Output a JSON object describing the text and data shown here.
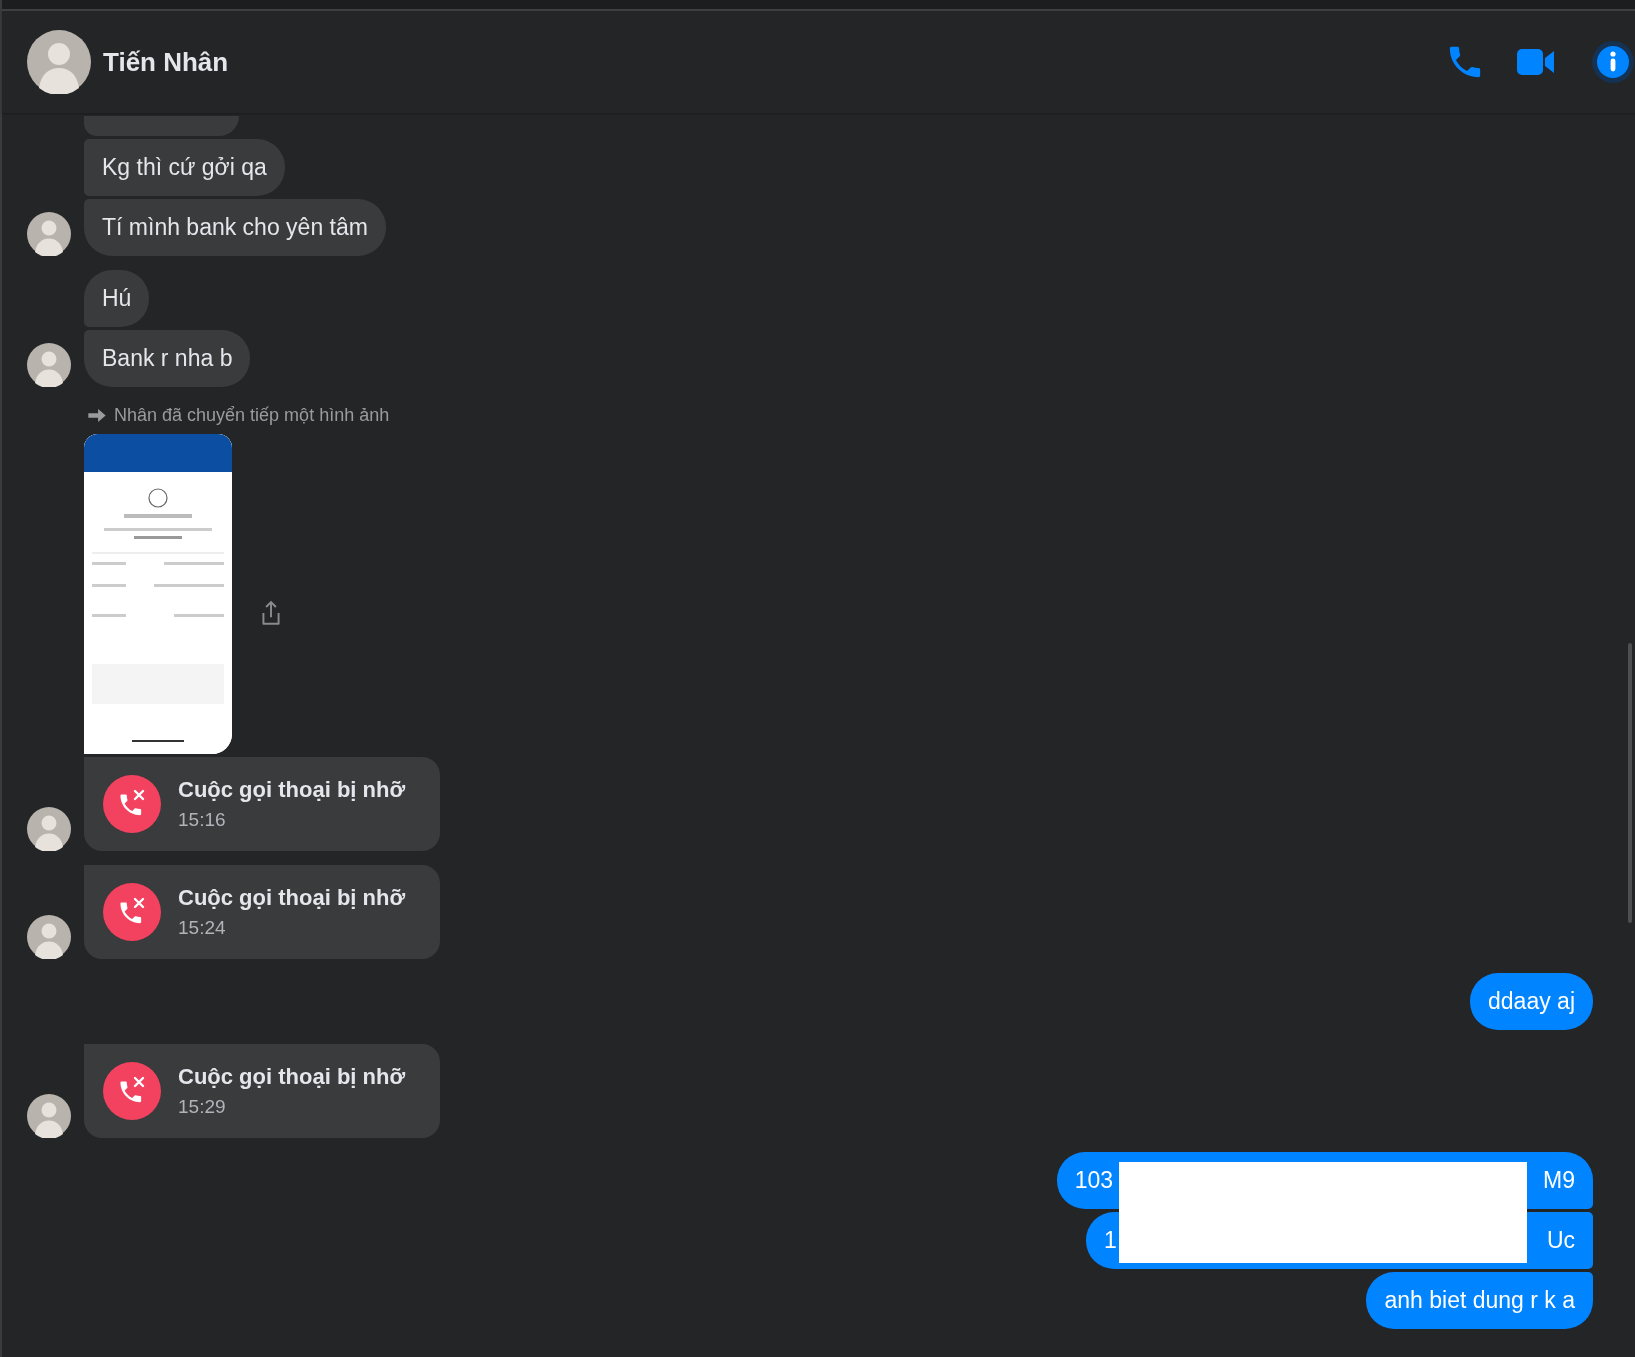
{
  "header": {
    "name": "Tiến Nhân"
  },
  "messages": [
    {
      "kind": "cut_bubble",
      "outgoing": false,
      "avatar": false
    },
    {
      "kind": "text",
      "outgoing": false,
      "text": "Kg thì cứ gởi qa",
      "avatar": false
    },
    {
      "kind": "text",
      "outgoing": false,
      "text": "Tí mình bank cho yên tâm",
      "avatar": true
    },
    {
      "kind": "text",
      "outgoing": false,
      "text": "Hú",
      "avatar": false
    },
    {
      "kind": "text",
      "outgoing": false,
      "text": "Bank r nha b",
      "avatar": true
    },
    {
      "kind": "forward_note",
      "outgoing": false,
      "text": "Nhân đã chuyển tiếp một hình ảnh",
      "avatar": false
    },
    {
      "kind": "picture",
      "outgoing": false,
      "avatar": false
    },
    {
      "kind": "missed_call",
      "outgoing": false,
      "title": "Cuộc gọi thoại bị nhỡ",
      "time": "15:16",
      "avatar": true
    },
    {
      "kind": "missed_call",
      "outgoing": false,
      "title": "Cuộc gọi thoại bị nhỡ",
      "time": "15:24",
      "avatar": true
    },
    {
      "kind": "text",
      "outgoing": true,
      "text": "ddaay aj",
      "avatar": false
    },
    {
      "kind": "missed_call",
      "outgoing": false,
      "title": "Cuộc gọi thoại bị nhỡ",
      "time": "15:29",
      "avatar": true
    },
    {
      "kind": "redacted_text",
      "outgoing": true,
      "text_start": "103",
      "text_end": "M9",
      "avatar": false
    },
    {
      "kind": "redacted_text",
      "outgoing": true,
      "text_start": "1",
      "text_end": "Uc",
      "avatar": false
    },
    {
      "kind": "text",
      "outgoing": true,
      "text": "anh biet dung r k a",
      "avatar": false
    }
  ]
}
